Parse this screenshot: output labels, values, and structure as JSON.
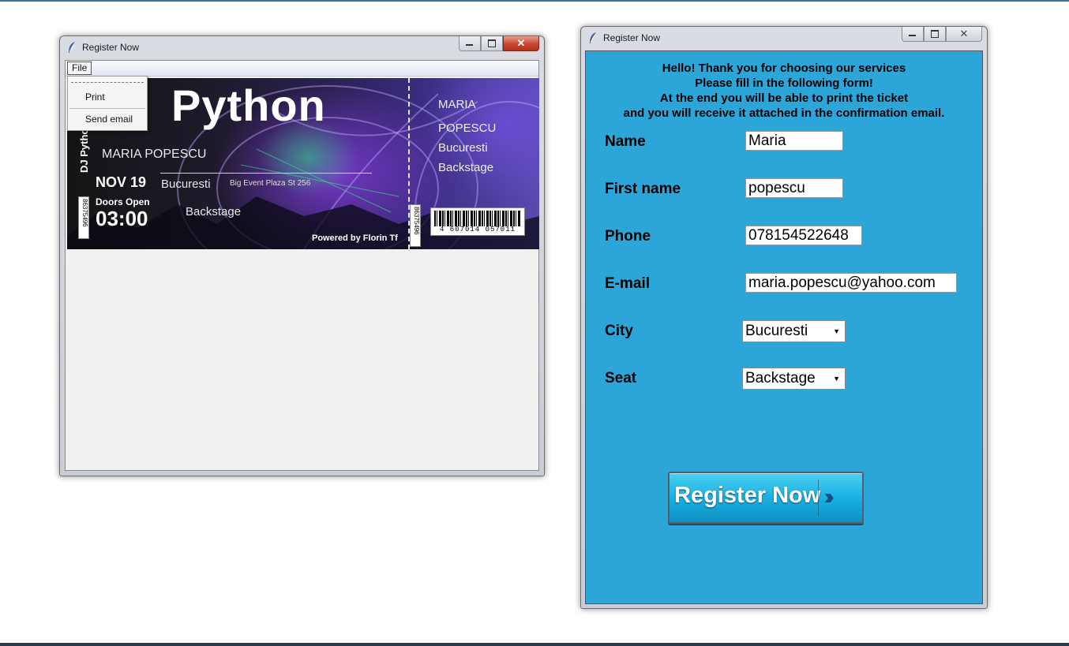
{
  "ticket_window": {
    "title": "Register Now",
    "menu": {
      "file_label": "File",
      "items": [
        "Print",
        "Send email"
      ]
    },
    "ticket": {
      "title": "Python",
      "vertical_label": "DJ Python",
      "full_name": "MARIA  POPESCU",
      "date": "NOV 19",
      "city": "Bucuresti",
      "venue": "Big Event Plaza St 256",
      "doors_label": "Doors Open",
      "time": "03:00",
      "seat": "Backstage",
      "powered_by": "Powered by Florin Tf",
      "serial": "86375496",
      "stub": {
        "first_name": "MARIA",
        "last_name": "POPESCU",
        "city": "Bucuresti",
        "seat": "Backstage"
      },
      "barcode_number": "4 607014 057011"
    }
  },
  "form_window": {
    "title": "Register Now",
    "intro_lines": [
      "Hello! Thank you for choosing our services",
      "Please fill in the following form!",
      "At the end you will be able to print the ticket",
      "and you will receive it attached in the confirmation email."
    ],
    "fields": {
      "name": {
        "label": "Name",
        "value": "Maria"
      },
      "first_name": {
        "label": "First name",
        "value": "popescu"
      },
      "phone": {
        "label": "Phone",
        "value": "078154522648"
      },
      "email": {
        "label": "E-mail",
        "value": "maria.popescu@yahoo.com"
      },
      "city": {
        "label": "City",
        "value": "Bucuresti"
      },
      "seat": {
        "label": "Seat",
        "value": "Backstage"
      }
    },
    "register_button": "Register Now",
    "register_button_icon": "double-chevron-right-icon"
  },
  "colors": {
    "form_background": "#2ca5d8",
    "button_gradient_top": "#4bd0f2",
    "button_gradient_bottom": "#0f8fc0",
    "close_button": "#c9452c"
  }
}
